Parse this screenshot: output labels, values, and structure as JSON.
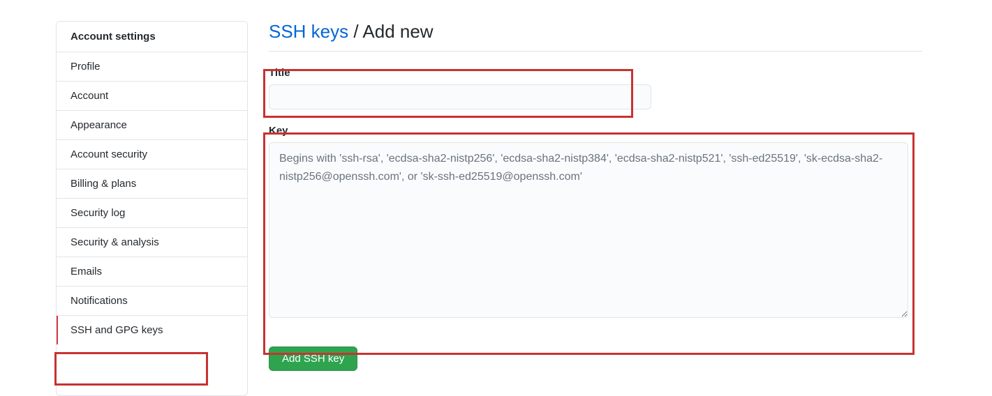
{
  "sidebar": {
    "header": "Account settings",
    "items": [
      {
        "label": "Profile"
      },
      {
        "label": "Account"
      },
      {
        "label": "Appearance"
      },
      {
        "label": "Account security"
      },
      {
        "label": "Billing & plans"
      },
      {
        "label": "Security log"
      },
      {
        "label": "Security & analysis"
      },
      {
        "label": "Emails"
      },
      {
        "label": "Notifications"
      },
      {
        "label": "SSH and GPG keys"
      }
    ]
  },
  "heading": {
    "link_text": "SSH keys",
    "separator": " / ",
    "sub": "Add new"
  },
  "form": {
    "title": {
      "label": "Title",
      "value": ""
    },
    "key": {
      "label": "Key",
      "placeholder": "Begins with 'ssh-rsa', 'ecdsa-sha2-nistp256', 'ecdsa-sha2-nistp384', 'ecdsa-sha2-nistp521', 'ssh-ed25519', 'sk-ecdsa-sha2-nistp256@openssh.com', or 'sk-ssh-ed25519@openssh.com'",
      "value": ""
    },
    "submit_label": "Add SSH key"
  }
}
